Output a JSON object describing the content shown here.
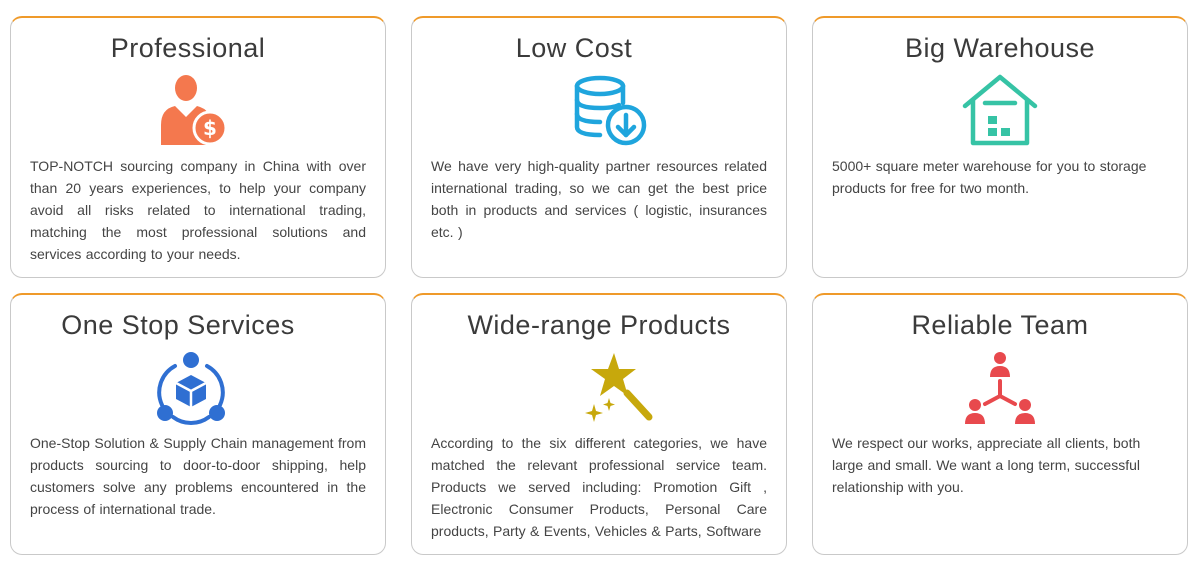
{
  "accent_color": "#ef9a2a",
  "cards": [
    {
      "title": "Professional",
      "icon": "professional-person-dollar-icon",
      "icon_color": "#f4784e",
      "text": "TOP-NOTCH sourcing company in China with over than 20 years experiences, to help your company avoid all risks related to international trading, matching the most professional solutions and services according to your needs."
    },
    {
      "title": "Low Cost",
      "icon": "database-download-icon",
      "icon_color": "#1fa5dd",
      "text": "We have very high-quality partner resources related international trading, so we can get the best price both in products and services ( logistic, insurances etc. )"
    },
    {
      "title": "Big Warehouse",
      "icon": "warehouse-icon",
      "icon_color": "#36c3a5",
      "text": "5000+ square meter warehouse for you to storage products for free for two month."
    },
    {
      "title": "One Stop Services",
      "icon": "box-network-icon",
      "icon_color": "#2f6fd2",
      "text": "One-Stop Solution & Supply Chain management from products sourcing to door-to-door shipping, help customers solve any problems encountered in the process of international trade."
    },
    {
      "title": "Wide-range Products",
      "icon": "magic-wand-star-icon",
      "icon_color": "#c7a80c",
      "text": "According to the six different categories, we have matched the relevant professional service team. Products we served including: Promotion Gift , Electronic Consumer Products, Personal Care products, Party & Events, Vehicles & Parts, Software"
    },
    {
      "title": "Reliable Team",
      "icon": "team-hierarchy-icon",
      "icon_color": "#e8494d",
      "text": "We respect our works, appreciate all clients, both large and small. We want a long term, successful relationship with you."
    }
  ]
}
